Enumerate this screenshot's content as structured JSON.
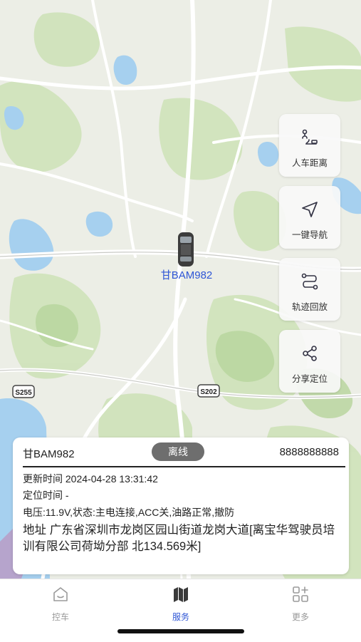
{
  "map": {
    "road_badges": [
      "S255",
      "S202"
    ]
  },
  "side_actions": [
    {
      "label": "人车距离",
      "icon": "distance-icon"
    },
    {
      "label": "一键导航",
      "icon": "navigation-arrow-icon"
    },
    {
      "label": "轨迹回放",
      "icon": "track-replay-icon"
    },
    {
      "label": "分享定位",
      "icon": "share-icon"
    }
  ],
  "vehicle": {
    "plate": "甘BAM982",
    "map_label": "甘BAM982"
  },
  "info_card": {
    "plate": "甘BAM982",
    "status": "离线",
    "phone": "8888888888",
    "update_time": "更新时间 2024-04-28 13:31:42",
    "location_time": "定位时间 -",
    "state_line": "电压:11.9V,状态:主电连接,ACC关,油路正常,撤防",
    "address": "地址 广东省深圳市龙岗区园山街道龙岗大道[离宝华驾驶员培训有限公司荷坳分部 北134.569米]"
  },
  "tabs": [
    {
      "label": "控车",
      "icon": "car-control-icon",
      "active": false
    },
    {
      "label": "服务",
      "icon": "map-icon",
      "active": true
    },
    {
      "label": "更多",
      "icon": "more-grid-icon",
      "active": false
    }
  ],
  "colors": {
    "accent": "#2f56d6",
    "status_bg": "#6e6e6e",
    "map_land": "#e9ece4",
    "map_green": "#c9dfb3",
    "map_water": "#9fcbe9",
    "map_road": "#ffffff"
  }
}
